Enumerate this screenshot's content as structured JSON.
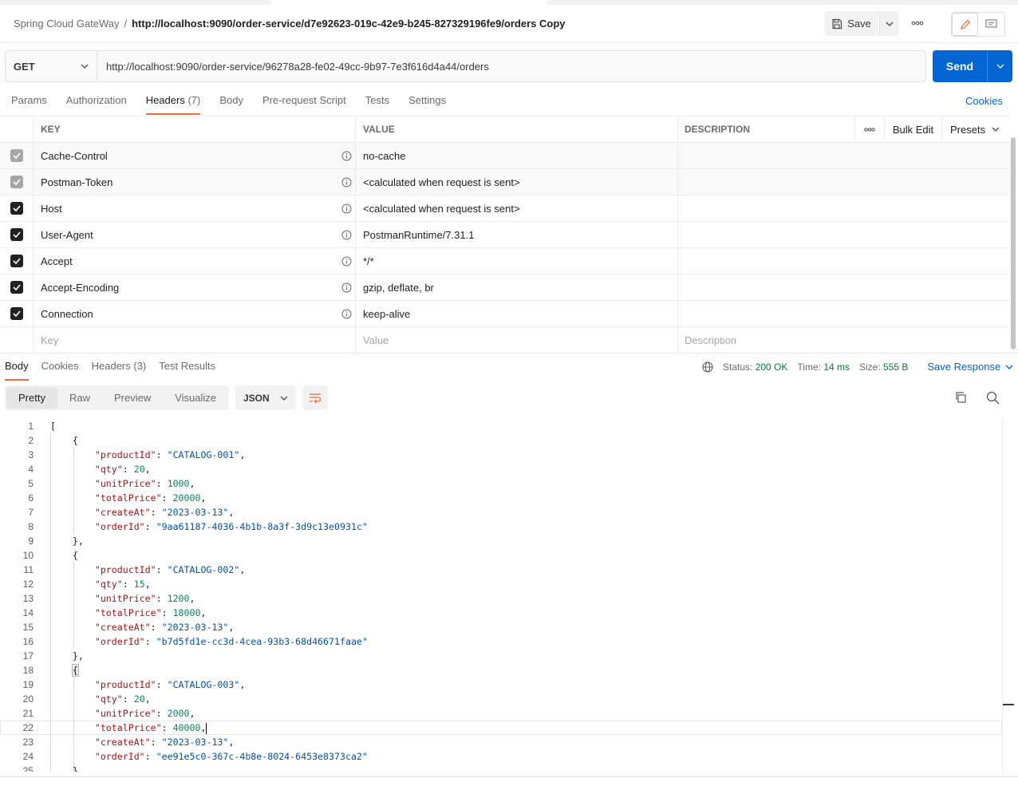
{
  "title_row": {
    "collection": "Spring Cloud GateWay",
    "separator": "/",
    "request_name": "http://localhost:9090/order-service/d7e92623-019c-42e9-b245-827329196fe9/orders Copy",
    "save_label": "Save"
  },
  "request": {
    "method": "GET",
    "url": "http://localhost:9090/order-service/96278a28-fe02-49cc-9b97-7e3f616d4a44/orders",
    "send_label": "Send"
  },
  "request_tabs": [
    {
      "label": "Params",
      "count": ""
    },
    {
      "label": "Authorization",
      "count": ""
    },
    {
      "label": "Headers",
      "count": "(7)"
    },
    {
      "label": "Body",
      "count": ""
    },
    {
      "label": "Pre-request Script",
      "count": ""
    },
    {
      "label": "Tests",
      "count": ""
    },
    {
      "label": "Settings",
      "count": ""
    }
  ],
  "cookies_link": "Cookies",
  "headers_table": {
    "columns": {
      "key": "KEY",
      "value": "VALUE",
      "description": "DESCRIPTION",
      "bulk_edit": "Bulk Edit",
      "presets": "Presets"
    },
    "rows": [
      {
        "key": "Cache-Control",
        "value": "no-cache",
        "checked": true,
        "auto": true
      },
      {
        "key": "Postman-Token",
        "value": "<calculated when request is sent>",
        "checked": true,
        "auto": true
      },
      {
        "key": "Host",
        "value": "<calculated when request is sent>",
        "checked": true,
        "auto": false
      },
      {
        "key": "User-Agent",
        "value": "PostmanRuntime/7.31.1",
        "checked": true,
        "auto": false
      },
      {
        "key": "Accept",
        "value": "*/*",
        "checked": true,
        "auto": false
      },
      {
        "key": "Accept-Encoding",
        "value": "gzip, deflate, br",
        "checked": true,
        "auto": false
      },
      {
        "key": "Connection",
        "value": "keep-alive",
        "checked": true,
        "auto": false
      }
    ],
    "new_row": {
      "key_placeholder": "Key",
      "value_placeholder": "Value",
      "description_placeholder": "Description"
    }
  },
  "response_tabs": [
    {
      "label": "Body",
      "count": ""
    },
    {
      "label": "Cookies",
      "count": ""
    },
    {
      "label": "Headers",
      "count": "(3)"
    },
    {
      "label": "Test Results",
      "count": ""
    }
  ],
  "response_status": {
    "status_label": "Status:",
    "status_value": "200 OK",
    "time_label": "Time:",
    "time_value": "14 ms",
    "size_label": "Size:",
    "size_value": "555 B",
    "save_response": "Save Response"
  },
  "body_toolbar": {
    "formats": [
      "Pretty",
      "Raw",
      "Preview",
      "Visualize"
    ],
    "active_format": "Pretty",
    "language": "JSON"
  },
  "response_body": [
    {
      "productId": "CATALOG-001",
      "qty": 20,
      "unitPrice": 1000,
      "totalPrice": 20000,
      "createAt": "2023-03-13",
      "orderId": "9aa61187-4036-4b1b-8a3f-3d9c13e0931c"
    },
    {
      "productId": "CATALOG-002",
      "qty": 15,
      "unitPrice": 1200,
      "totalPrice": 18000,
      "createAt": "2023-03-13",
      "orderId": "b7d5fd1e-cc3d-4cea-93b3-68d46671faae"
    },
    {
      "productId": "CATALOG-003",
      "qty": 20,
      "unitPrice": 2000,
      "totalPrice": 40000,
      "createAt": "2023-03-13",
      "orderId": "ee91e5c0-367c-4b8e-8024-6453e8373ca2"
    }
  ],
  "colors": {
    "accent_blue": "#0265d2",
    "tab_underline": "#f26b3a",
    "status_ok": "#007f31",
    "json_key": "#a31515",
    "json_string": "#0451a5",
    "json_number": "#098658"
  },
  "icons": [
    "save-icon",
    "chevron-down-icon",
    "more-icon",
    "pencil-icon",
    "comment-icon",
    "info-icon",
    "globe-icon",
    "wrap-lines-icon",
    "copy-icon",
    "search-icon"
  ]
}
